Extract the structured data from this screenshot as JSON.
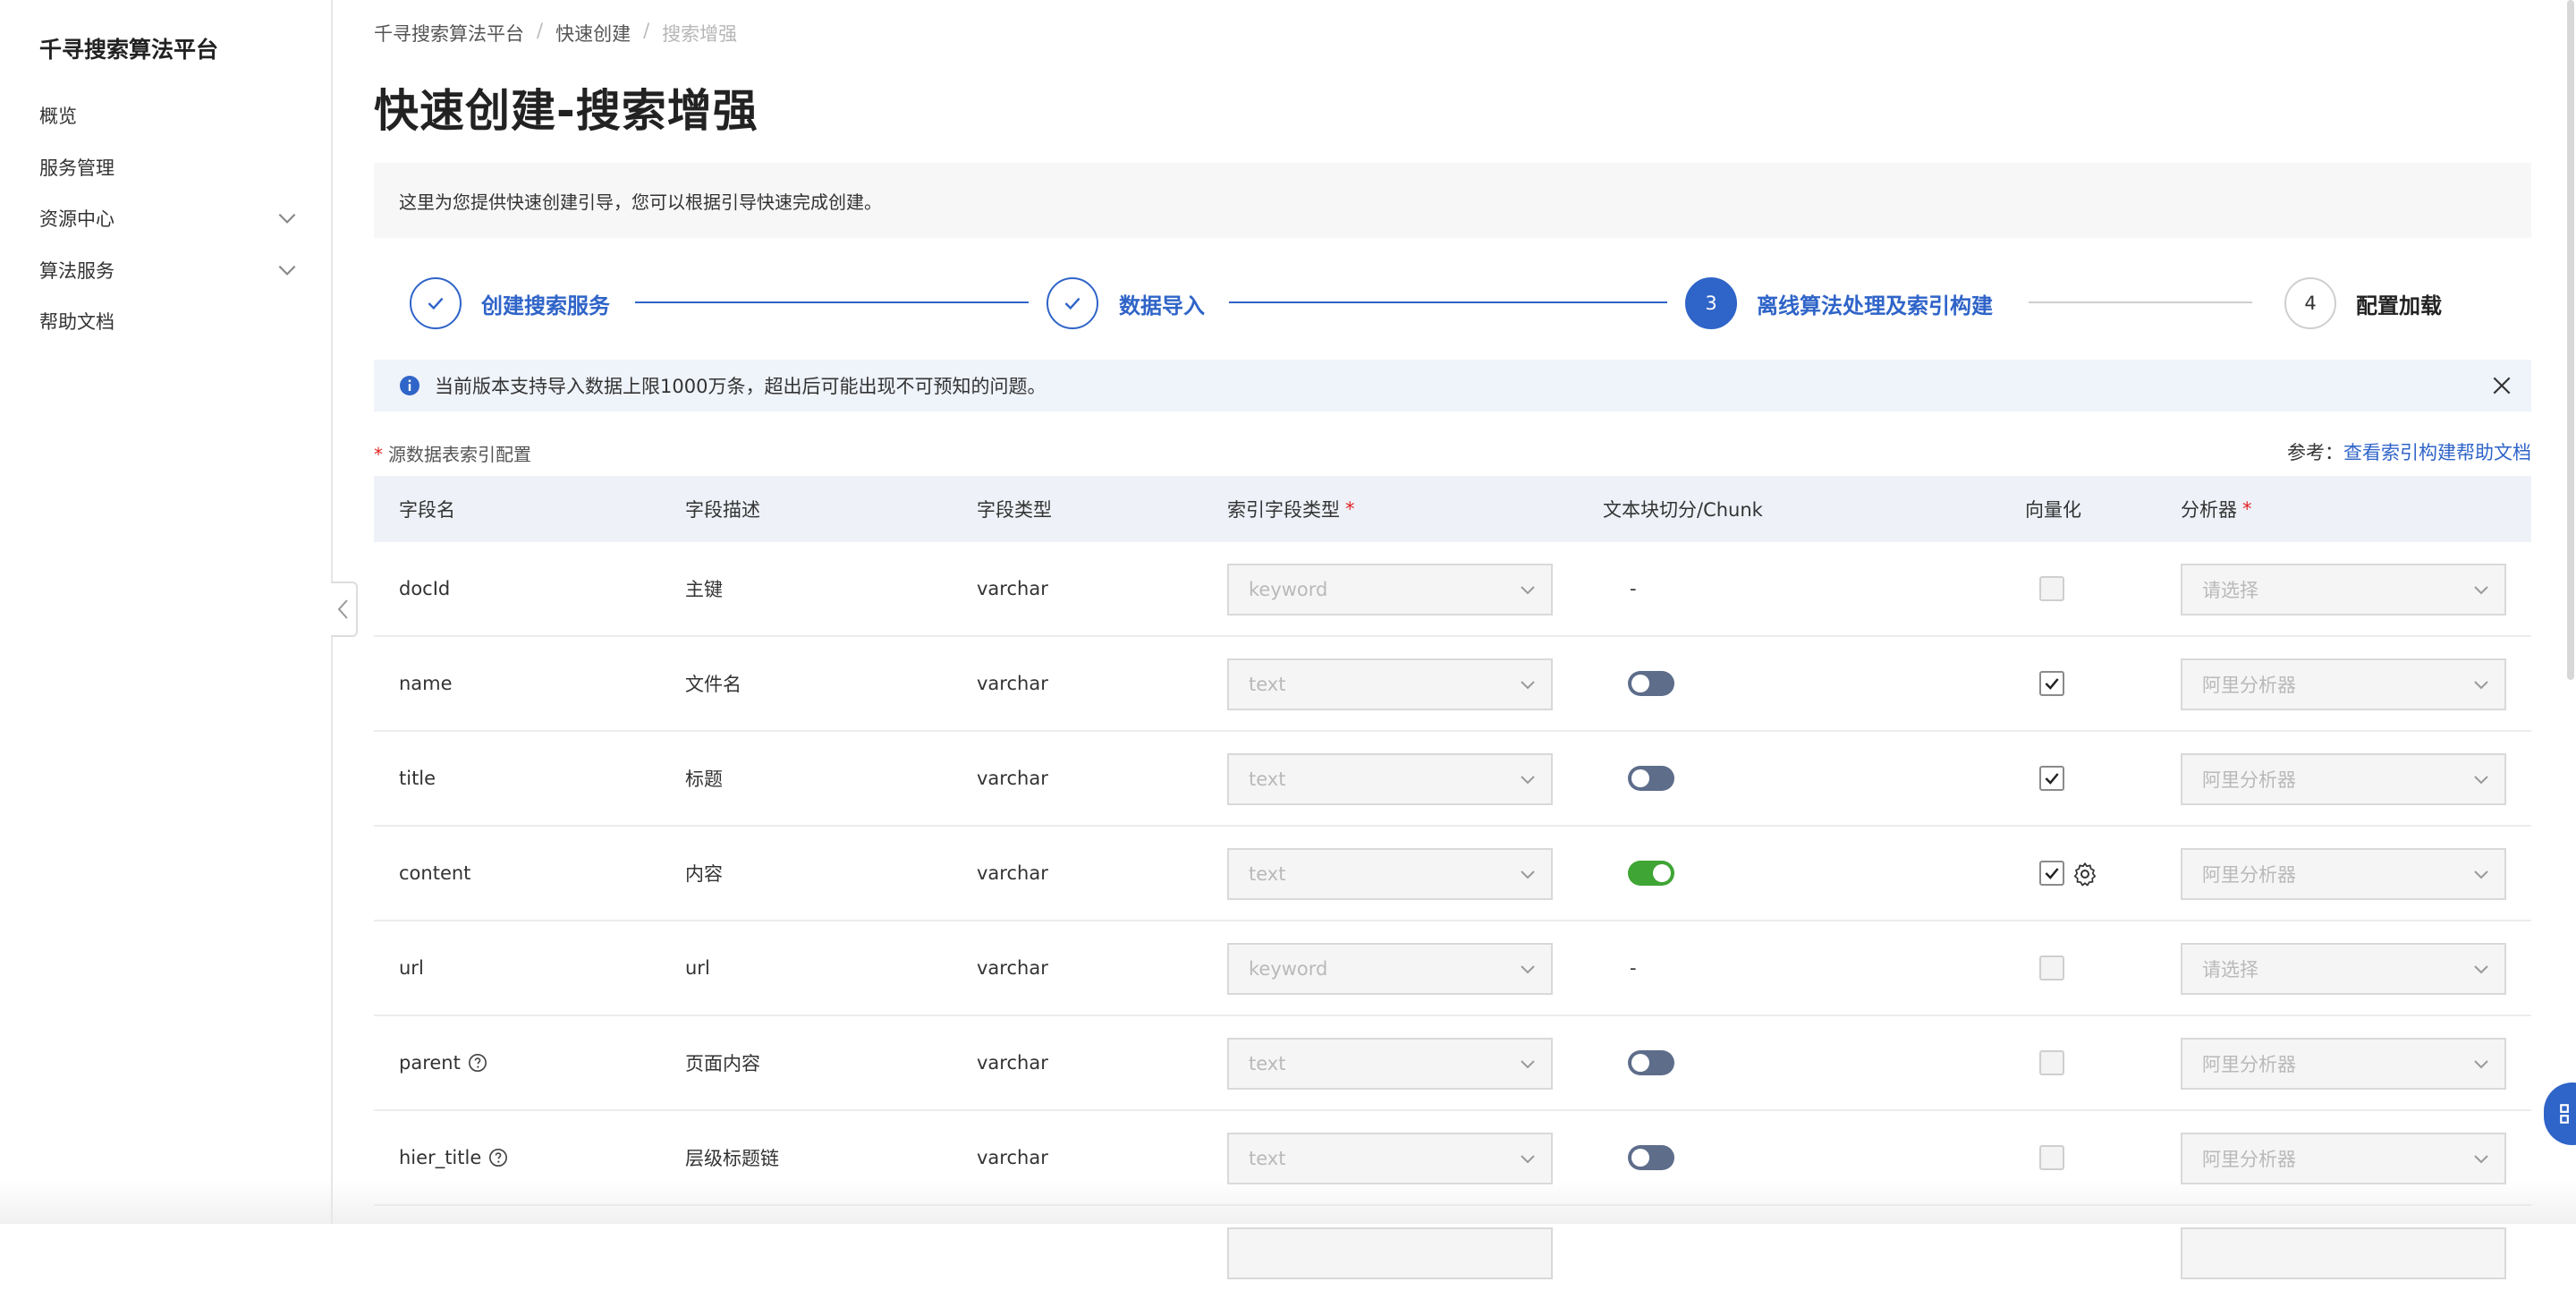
{
  "sidebar": {
    "brand": "千寻搜索算法平台",
    "items": [
      {
        "label": "概览",
        "expandable": false
      },
      {
        "label": "服务管理",
        "expandable": false
      },
      {
        "label": "资源中心",
        "expandable": true
      },
      {
        "label": "算法服务",
        "expandable": true
      },
      {
        "label": "帮助文档",
        "expandable": false
      }
    ]
  },
  "breadcrumb": {
    "root": "千寻搜索算法平台",
    "parent": "快速创建",
    "current": "搜索增强",
    "separator": "/"
  },
  "page": {
    "title": "快速创建-搜索增强",
    "intro": "这里为您提供快速创建引导，您可以根据引导快速完成创建。"
  },
  "steps": [
    {
      "label": "创建搜索服务",
      "status": "done"
    },
    {
      "label": "数据导入",
      "status": "done"
    },
    {
      "number": "3",
      "label": "离线算法处理及索引构建",
      "status": "active"
    },
    {
      "number": "4",
      "label": "配置加载",
      "status": "todo"
    }
  ],
  "alert": {
    "text": "当前版本支持导入数据上限1000万条，超出后可能出现不可预知的问题。"
  },
  "section": {
    "required_mark": "*",
    "label": "源数据表索引配置",
    "ref_prefix": "参考：",
    "ref_link": "查看索引构建帮助文档"
  },
  "table": {
    "headers": {
      "field_name": "字段名",
      "field_desc": "字段描述",
      "field_type": "字段类型",
      "index_type": "索引字段类型",
      "chunk": "文本块切分/Chunk",
      "vectorize": "向量化",
      "analyzer": "分析器",
      "required_mark": "*"
    },
    "rows": [
      {
        "name": "docId",
        "desc": "主键",
        "type": "varchar",
        "index_type": "keyword",
        "chunk": "-",
        "vectorized": false,
        "analyzer": "请选择"
      },
      {
        "name": "name",
        "desc": "文件名",
        "type": "varchar",
        "index_type": "text",
        "chunk": "off",
        "vectorized": true,
        "analyzer": "阿里分析器"
      },
      {
        "name": "title",
        "desc": "标题",
        "type": "varchar",
        "index_type": "text",
        "chunk": "off",
        "vectorized": true,
        "analyzer": "阿里分析器"
      },
      {
        "name": "content",
        "desc": "内容",
        "type": "varchar",
        "index_type": "text",
        "chunk": "on",
        "vectorized": true,
        "analyzer": "阿里分析器"
      },
      {
        "name": "url",
        "desc": "url",
        "type": "varchar",
        "index_type": "keyword",
        "chunk": "-",
        "vectorized": false,
        "analyzer": "请选择"
      },
      {
        "name": "parent",
        "desc": "页面内容",
        "type": "varchar",
        "index_type": "text",
        "chunk": "off",
        "vectorized": false,
        "analyzer": "阿里分析器",
        "help": true
      },
      {
        "name": "hier_title",
        "desc": "层级标题链",
        "type": "varchar",
        "index_type": "text",
        "chunk": "off",
        "vectorized": false,
        "analyzer": "阿里分析器",
        "help": true
      }
    ]
  },
  "colors": {
    "accent": "#2f64c8",
    "toggle_on": "#3fa535",
    "toggle_off": "#5d6d8a",
    "required": "#e02424"
  }
}
